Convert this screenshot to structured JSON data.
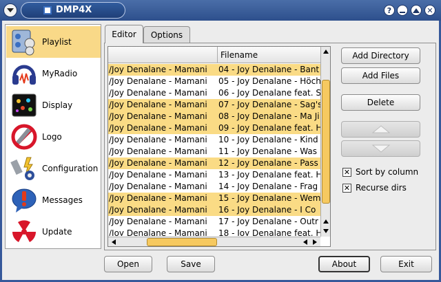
{
  "window": {
    "title": "DMP4X",
    "buttons": [
      "?",
      "_",
      "▲",
      "✕"
    ]
  },
  "sidebar": {
    "items": [
      {
        "label": "Playlist",
        "icon": "playlist-icon",
        "active": true
      },
      {
        "label": "MyRadio",
        "icon": "headphones-icon",
        "active": false
      },
      {
        "label": "Display",
        "icon": "display-icon",
        "active": false
      },
      {
        "label": "Logo",
        "icon": "logo-icon",
        "active": false
      },
      {
        "label": "Configuration",
        "icon": "configuration-icon",
        "active": false
      },
      {
        "label": "Messages",
        "icon": "messages-icon",
        "active": false
      },
      {
        "label": "Update",
        "icon": "update-icon",
        "active": false
      }
    ]
  },
  "tabs": [
    {
      "label": "Editor",
      "active": true
    },
    {
      "label": "Options",
      "active": false
    }
  ],
  "table": {
    "columns": [
      "",
      "Filename"
    ],
    "rows": [
      {
        "dir": "/Joy Denalane - Mamani",
        "file": "04 - Joy Denalane - Bant",
        "highlight": true
      },
      {
        "dir": "/Joy Denalane - Mamani",
        "file": "05 - Joy Denalane - Höch",
        "highlight": false
      },
      {
        "dir": "/Joy Denalane - Mamani",
        "file": "06 - Joy Denalane feat. S",
        "highlight": false
      },
      {
        "dir": "/Joy Denalane - Mamani",
        "file": "07 - Joy Denalane - Sag's",
        "highlight": true
      },
      {
        "dir": "/Joy Denalane - Mamani",
        "file": "08 - Joy Denalane - Ma Ji",
        "highlight": true
      },
      {
        "dir": "/Joy Denalane - Mamani",
        "file": "09 - Joy Denalane feat. H",
        "highlight": true
      },
      {
        "dir": "/Joy Denalane - Mamani",
        "file": "10 - Joy Denalane - Kind",
        "highlight": false
      },
      {
        "dir": "/Joy Denalane - Mamani",
        "file": "11 - Joy Denalane - Was",
        "highlight": false
      },
      {
        "dir": "/Joy Denalane - Mamani",
        "file": "12 - Joy Denalane - Pass",
        "highlight": true
      },
      {
        "dir": "/Joy Denalane - Mamani",
        "file": "13 - Joy Denalane feat. H",
        "highlight": false
      },
      {
        "dir": "/Joy Denalane - Mamani",
        "file": "14 - Joy Denalane - Frag",
        "highlight": false
      },
      {
        "dir": "/Joy Denalane - Mamani",
        "file": "15 - Joy Denalane - Wem",
        "highlight": true
      },
      {
        "dir": "/Joy Denalane - Mamani",
        "file": "16 - Joy Denalane - I Co",
        "highlight": true
      },
      {
        "dir": "/Joy Denalane - Mamani",
        "file": "17 - Joy Denalane - Outr",
        "highlight": false
      },
      {
        "dir": "/Joy Denalane - Mamani",
        "file": "18 - Joy Denalane feat. H",
        "highlight": false
      }
    ]
  },
  "actions": {
    "add_directory": "Add Directory",
    "add_files": "Add Files",
    "delete": "Delete",
    "move_up_icon": "arrow-up-icon",
    "move_down_icon": "arrow-down-icon"
  },
  "options": {
    "sort_by_column": {
      "label": "Sort by column",
      "checked": true
    },
    "recurse_dirs": {
      "label": "Recurse dirs",
      "checked": true
    }
  },
  "footer": {
    "open": "Open",
    "save": "Save",
    "about": "About",
    "exit": "Exit"
  },
  "colors": {
    "titlebar": "#36589a",
    "highlight_row": "#fadb85",
    "active_sidebar": "#f9d988",
    "scroll_thumb": "#f6c960"
  }
}
